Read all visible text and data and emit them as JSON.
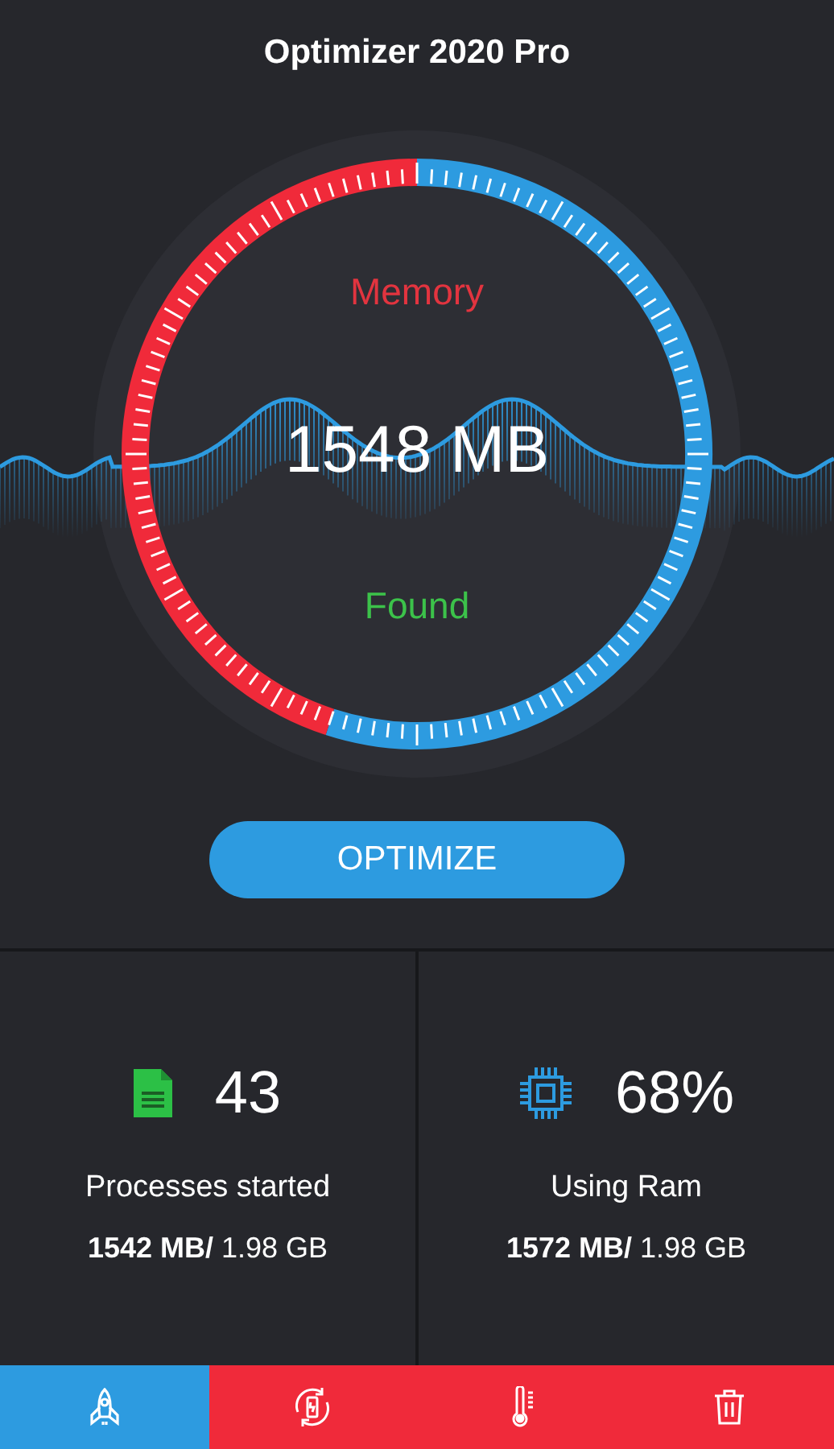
{
  "header": {
    "title": "Optimizer 2020 Pro"
  },
  "gauge": {
    "label_top": "Memory",
    "value": "1548 MB",
    "label_bottom": "Found"
  },
  "action": {
    "label": "OPTIMIZE"
  },
  "stats": [
    {
      "kind": "document",
      "value": "43",
      "label": "Processes started",
      "detail": "**1542 MB/** 1.98 GB"
    },
    {
      "kind": "chip",
      "value": "68%",
      "label": "Using Ram",
      "detail": "**1572 MB/** 1.98 GB"
    }
  ],
  "tabs": [
    {
      "kind": "rocket",
      "selected": true
    },
    {
      "kind": "battery",
      "selected": false
    },
    {
      "kind": "thermometer",
      "selected": false
    },
    {
      "kind": "trash",
      "selected": false
    }
  ]
}
